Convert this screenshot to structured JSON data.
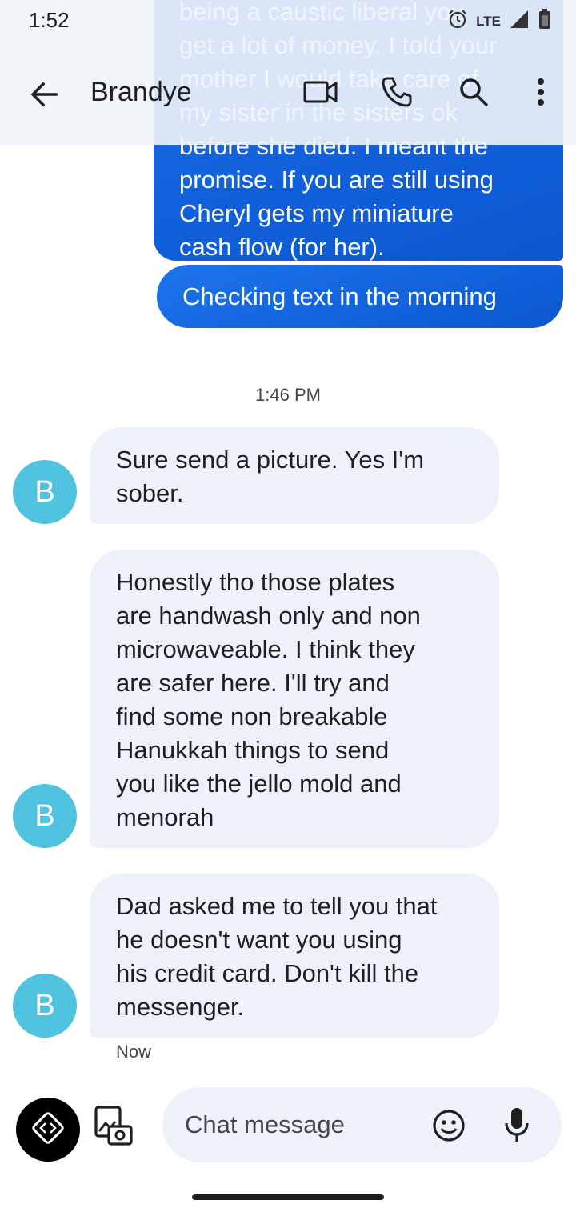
{
  "status_bar": {
    "time": "1:52",
    "network": "LTE",
    "icons": [
      "alarm-icon",
      "signal-icon",
      "battery-icon"
    ]
  },
  "header": {
    "contact_name": "Brandye",
    "actions": [
      "video-call-icon",
      "phone-icon",
      "search-icon",
      "more-vert-icon"
    ]
  },
  "conversation": {
    "outgoing": [
      {
        "text": "being a caustic liberal you\nget a lot of money. I told your\nmother I would take care of\nmy sister in the sisters ok\nbefore she died. I meant the\npromise. If you are still using\nCheryl gets my miniature\ncash flow (for her)."
      },
      {
        "text": "Checking text in the morning"
      }
    ],
    "timestamp": "1:46 PM",
    "incoming": [
      {
        "avatar": "B",
        "text": "Sure send a picture. Yes I'm\nsober."
      },
      {
        "avatar": "B",
        "text": "Honestly tho those plates\nare handwash only and non\nmicrowaveable. I think they\nare safer here. I'll try and\nfind some non breakable\nHanukkah things to send\nyou like the jello mold and\nmenorah"
      },
      {
        "avatar": "B",
        "text": "Dad asked me to tell you that\nhe doesn't want you using\nhis credit card. Don't kill the\nmessenger."
      }
    ],
    "last_status": "Now"
  },
  "composer": {
    "placeholder": "Chat message",
    "value": ""
  },
  "colors": {
    "outgoing_bubble": "#0b57d0",
    "incoming_bubble": "#edf2fa",
    "avatar": "#4fc3e0"
  }
}
